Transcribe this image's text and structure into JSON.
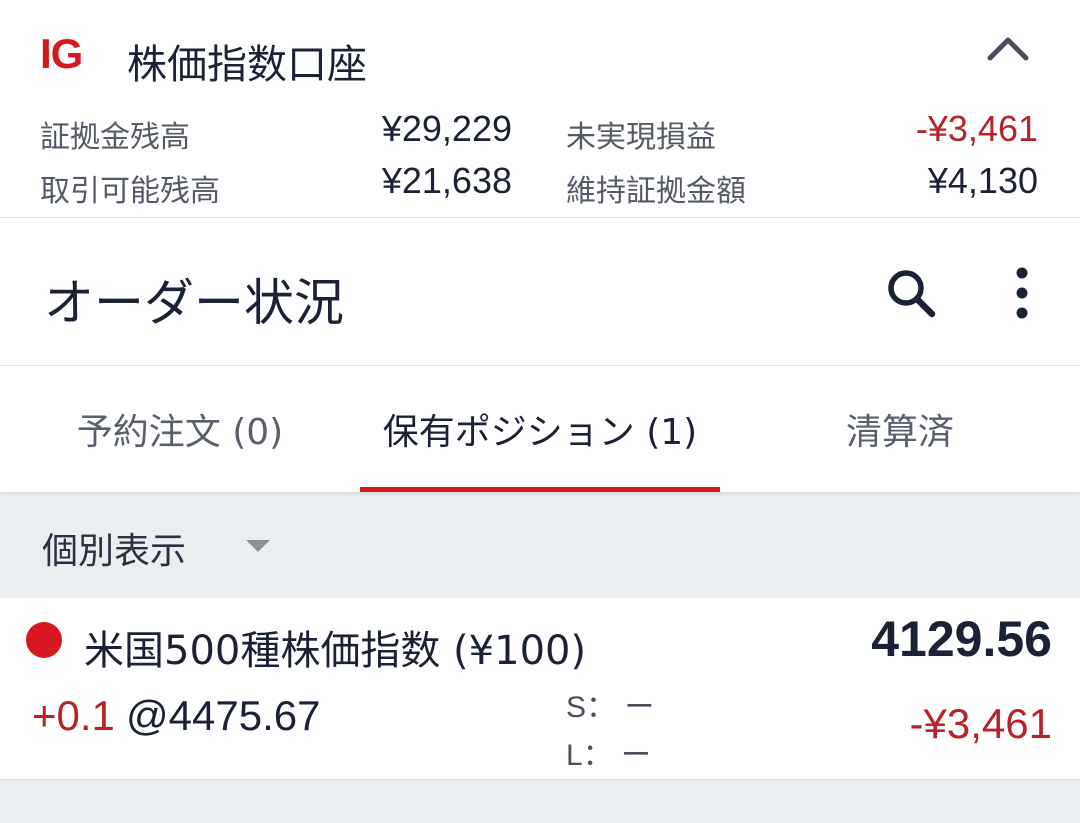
{
  "account": {
    "logo": "IG",
    "title": "株価指数口座",
    "margin_balance_label": "証拠金残高",
    "margin_balance": "¥29,229",
    "unrealized_label": "未実現損益",
    "unrealized": "-¥3,461",
    "available_label": "取引可能残高",
    "available": "¥21,638",
    "maintenance_label": "維持証拠金額",
    "maintenance": "¥4,130"
  },
  "header": {
    "title": "オーダー状況"
  },
  "tabs": [
    {
      "label": "予約注文 (0)",
      "active": false
    },
    {
      "label": "保有ポジション (1)",
      "active": true
    },
    {
      "label": "清算済",
      "active": false
    }
  ],
  "filter": {
    "label": "個別表示"
  },
  "position": {
    "name": "米国500種株価指数 (¥100)",
    "current_price": "4129.56",
    "size": "+0.1",
    "open_price": "@4475.67",
    "stop": "S：  ー",
    "limit": "L：  ー",
    "pnl": "-¥3,461"
  },
  "colors": {
    "brand_red": "#d7191f",
    "negative": "#b8222a",
    "text_dark": "#1c2236"
  },
  "icons": [
    "chevron-up-icon",
    "search-icon",
    "more-vertical-icon",
    "caret-down-icon",
    "direction-dot-icon"
  ]
}
